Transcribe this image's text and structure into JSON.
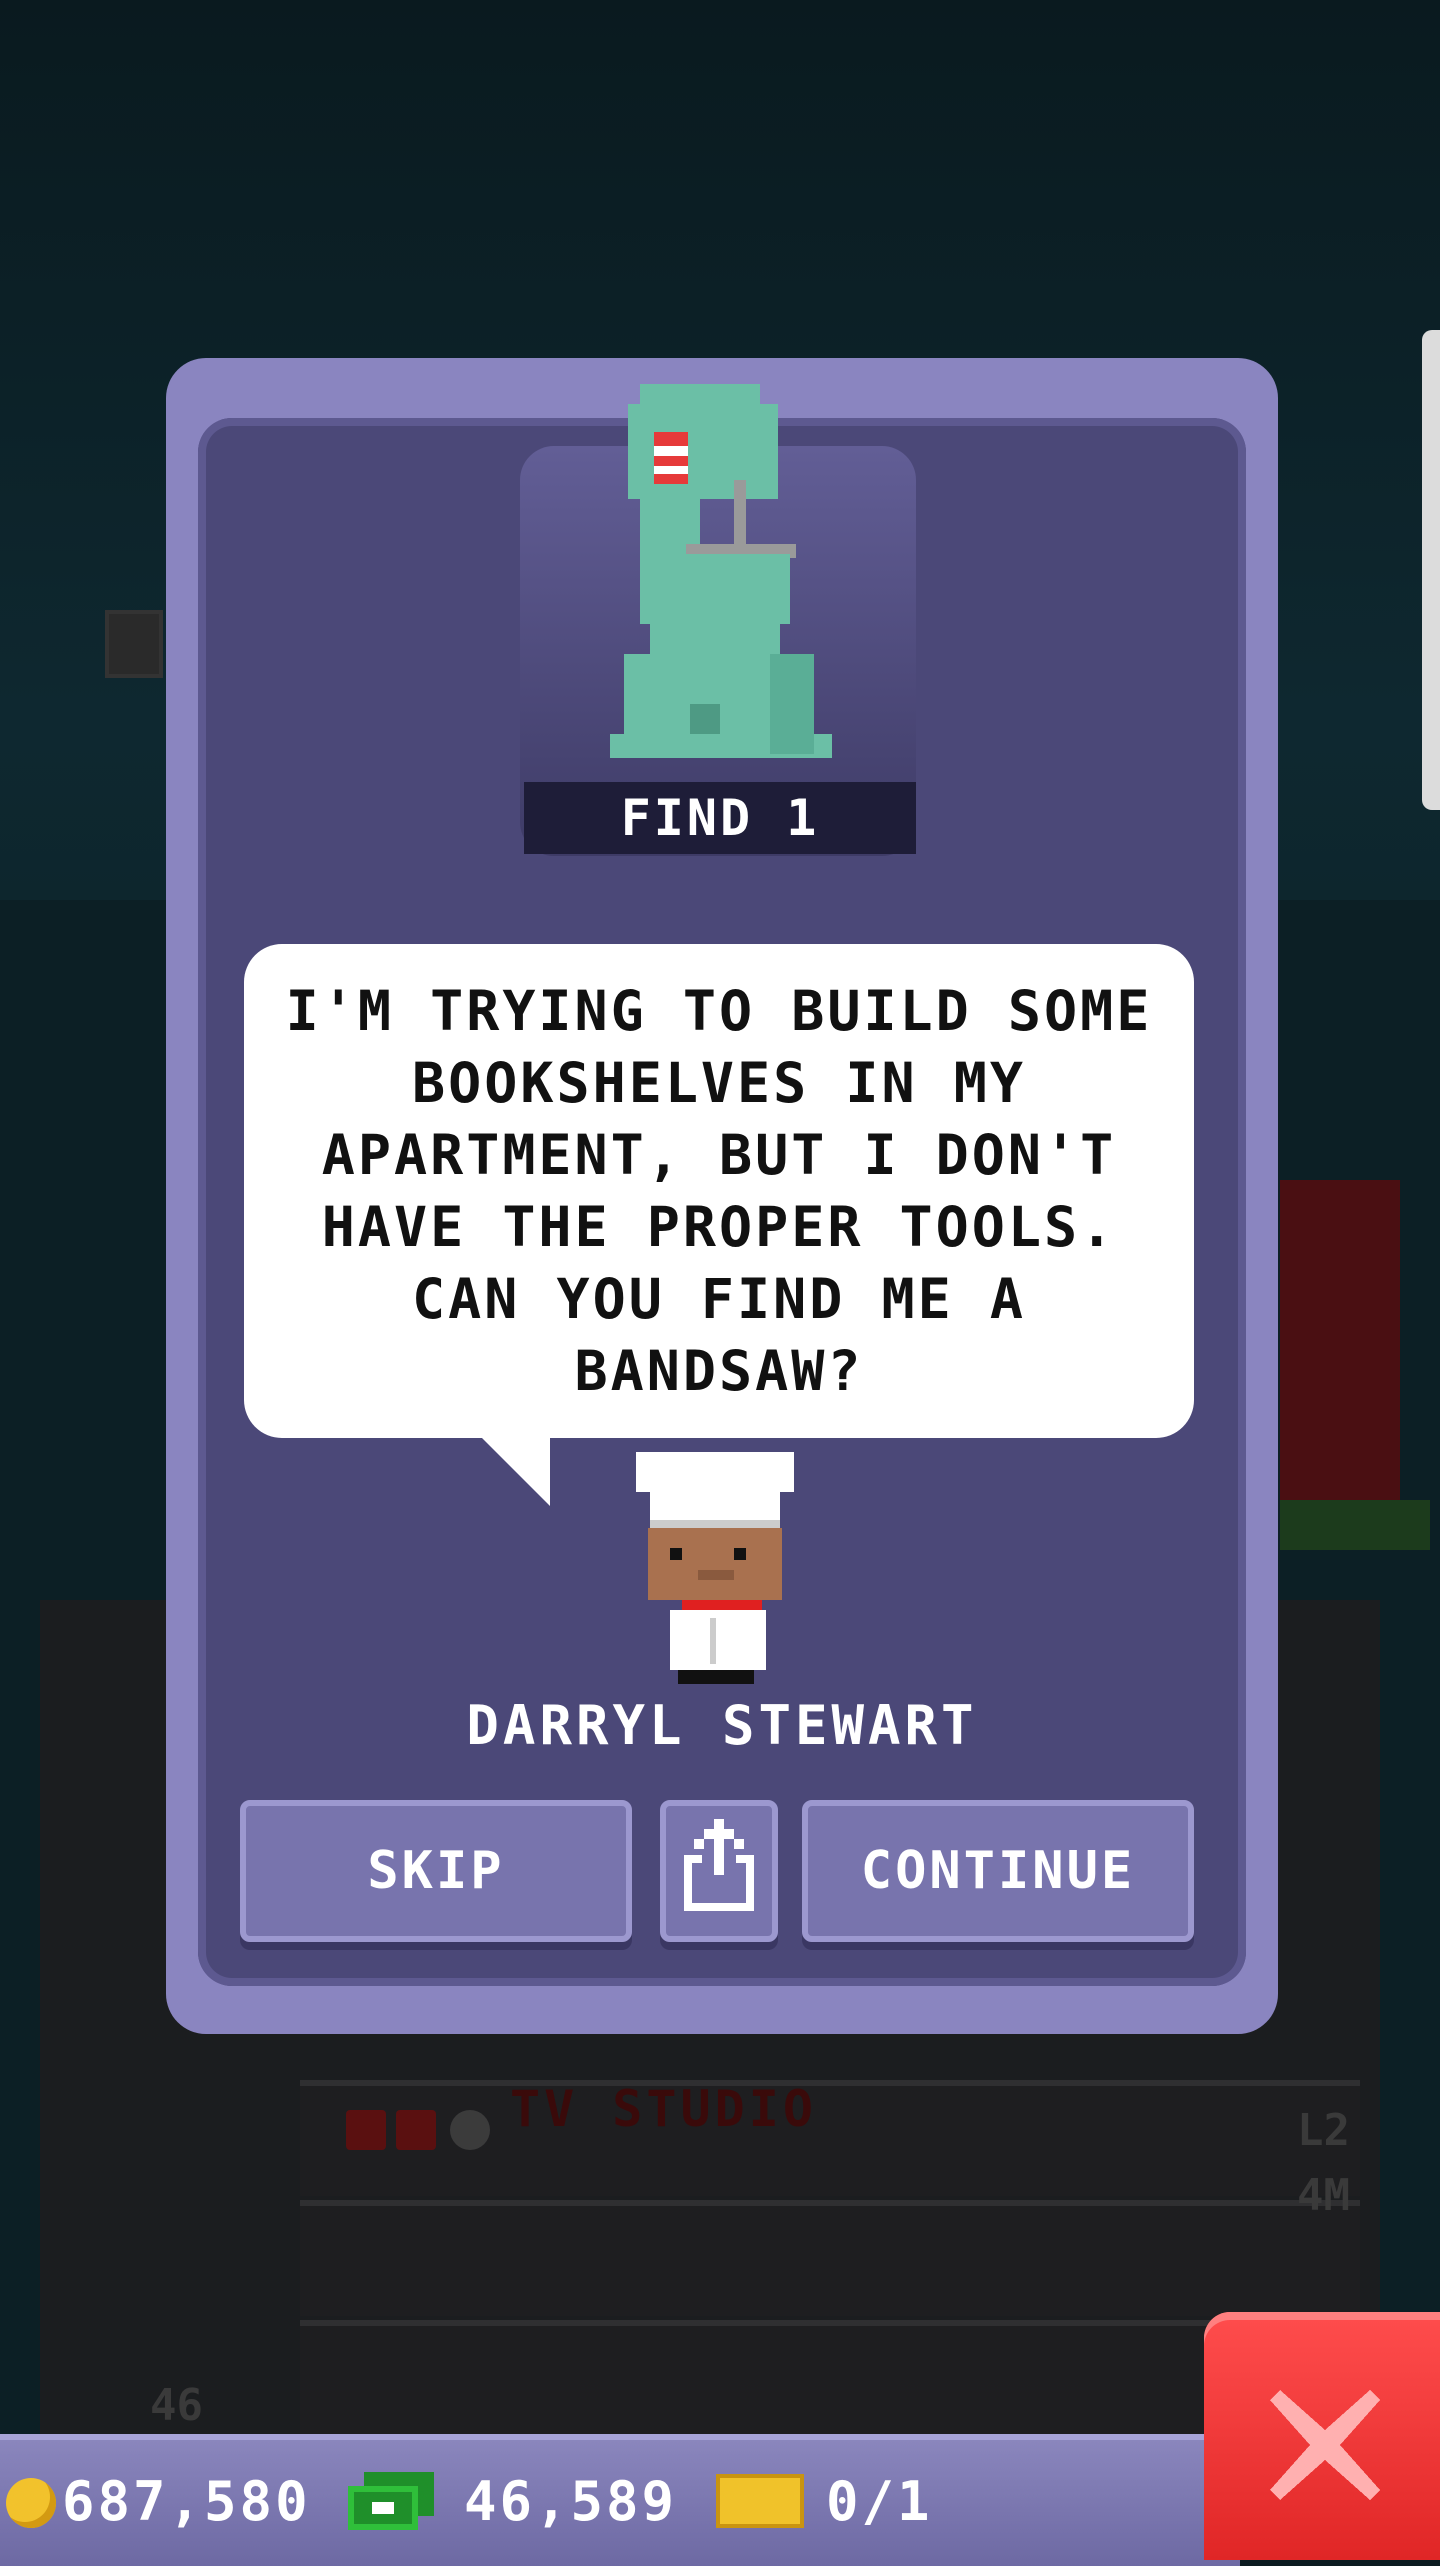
{
  "background": {
    "floor_name": "TV STUDIO",
    "floor_level": "L2",
    "floor_value": "4M",
    "floor_number": "46"
  },
  "dialog": {
    "item_label": "FIND 1",
    "speech": "I'M TRYING TO BUILD SOME BOOKSHELVES IN MY APARTMENT, BUT I DON'T HAVE THE PROPER TOOLS. CAN YOU FIND ME A BANDSAW?",
    "character_name": "DARRYL STEWART",
    "buttons": {
      "skip": "SKIP",
      "share_icon": "share-icon",
      "continue": "CONTINUE"
    },
    "item_icon": "bandsaw-icon"
  },
  "currency": {
    "coins": "687,580",
    "bux": "46,589",
    "tickets": "0/1"
  },
  "colors": {
    "dialog_outer": "#8a85c0",
    "dialog_inner": "#4b4878",
    "statue": "#6bbfa6",
    "close_button": "#e02626"
  }
}
